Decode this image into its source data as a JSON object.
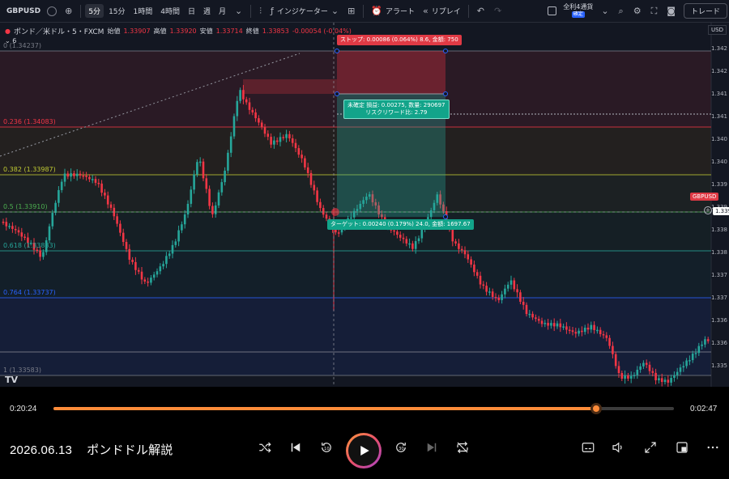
{
  "toolbar": {
    "symbol": "GBPUSD",
    "timeframes": [
      "5分",
      "15分",
      "1時間",
      "4時間",
      "日",
      "週",
      "月"
    ],
    "active_timeframe": "5分",
    "indicators_label": "インジケーター",
    "alert_label": "アラート",
    "replay_label": "リプレイ",
    "account_label": "全利4通貨",
    "account_badge": "確定",
    "trade_label": "トレード",
    "icons": [
      "add-icon",
      "candles-icon",
      "layout-icon",
      "alert-icon",
      "replay-icon",
      "undo-icon",
      "redo-icon",
      "settings-icon",
      "fullscreen-icon",
      "camera-icon"
    ]
  },
  "chart": {
    "title": "ポンド／米ドル・5・FXCM",
    "ohlc": {
      "open_label": "始値",
      "open": "1.33907",
      "high_label": "高値",
      "high": "1.33920",
      "low_label": "安値",
      "low": "1.33714",
      "close_label": "終値",
      "close": "1.33853",
      "change": "-0.00054 (-0.04%)"
    },
    "sub_legend": "6",
    "currency": "USD",
    "fib_levels": [
      {
        "label": "0 (1.34237)",
        "price": 1.34237,
        "color": "#787b86"
      },
      {
        "label": "0.236 (1.34083)",
        "price": 1.34083,
        "color": "#f23645"
      },
      {
        "label": "0.382 (1.33987)",
        "price": 1.33987,
        "color": "#c0ca33"
      },
      {
        "label": "0.5 (1.33910)",
        "price": 1.3391,
        "color": "#4caf50"
      },
      {
        "label": "0.618 (1.33833)",
        "price": 1.33833,
        "color": "#26a69a"
      },
      {
        "label": "0.764 (1.33737)",
        "price": 1.33737,
        "color": "#2962ff"
      },
      {
        "label": "1 (1.33583)",
        "price": 1.33583,
        "color": "#787b86"
      }
    ],
    "axis_labels": [
      "1.342",
      "1.342",
      "1.341",
      "1.341",
      "1.340",
      "1.340",
      "1.339",
      "1.339",
      "1.338",
      "1.338",
      "1.337",
      "1.337",
      "1.336",
      "1.336",
      "1.335"
    ],
    "axis_tags": {
      "gbpusd": "GBPUSD",
      "price": "1.339"
    },
    "stop_label": "ストップ: 0.00086 (0.064%) 8.6, 金額: 750",
    "open_pl_label": "未確定 損益: 0.00275, 数量: 290697",
    "rr_label": "リスクリワード比: 2.79",
    "target_label": "ターゲット: 0.00240 (0.179%) 24.0, 金額: 1697.67",
    "logo": "TV",
    "colors": {
      "up": "#26a69a",
      "down": "#f23645",
      "bg": "#131722"
    }
  },
  "player": {
    "current_time": "0:20:24",
    "total_time": "0:02:47",
    "progress": 0.875,
    "title_date": "2026.06.13",
    "title_text": "ポンドドル解説",
    "accent": "#ff8c3a",
    "icons": [
      "shuffle-icon",
      "previous-icon",
      "rewind-10-icon",
      "play-icon",
      "forward-30-icon",
      "next-icon",
      "repeat-icon",
      "subtitles-icon",
      "volume-icon",
      "expand-icon",
      "miniplayer-icon",
      "more-icon"
    ]
  }
}
